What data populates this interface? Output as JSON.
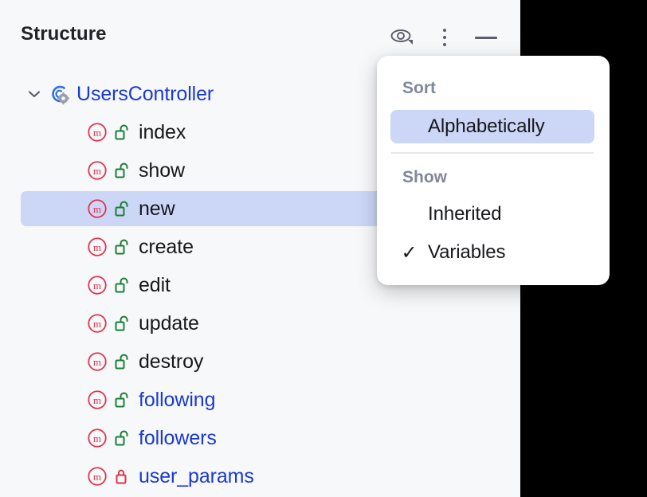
{
  "panel": {
    "title": "Structure",
    "header_actions": [
      {
        "name": "eye-icon",
        "label": "Show/Hide options"
      },
      {
        "name": "more-vertical-icon",
        "label": "Options"
      },
      {
        "name": "minimize-icon",
        "label": "Hide"
      }
    ]
  },
  "tree": {
    "root": {
      "label": "UsersController",
      "icon": "class-controller-icon",
      "expanded": true,
      "chevron": "chevron-down-icon"
    },
    "members": [
      {
        "label": "index",
        "icon": "method-icon",
        "visibility": "public",
        "lock_icon": "lock-open-icon",
        "selected": false,
        "link": false
      },
      {
        "label": "show",
        "icon": "method-icon",
        "visibility": "public",
        "lock_icon": "lock-open-icon",
        "selected": false,
        "link": false
      },
      {
        "label": "new",
        "icon": "method-icon",
        "visibility": "public",
        "lock_icon": "lock-open-icon",
        "selected": true,
        "link": false
      },
      {
        "label": "create",
        "icon": "method-icon",
        "visibility": "public",
        "lock_icon": "lock-open-icon",
        "selected": false,
        "link": false
      },
      {
        "label": "edit",
        "icon": "method-icon",
        "visibility": "public",
        "lock_icon": "lock-open-icon",
        "selected": false,
        "link": false
      },
      {
        "label": "update",
        "icon": "method-icon",
        "visibility": "public",
        "lock_icon": "lock-open-icon",
        "selected": false,
        "link": false
      },
      {
        "label": "destroy",
        "icon": "method-icon",
        "visibility": "public",
        "lock_icon": "lock-open-icon",
        "selected": false,
        "link": false
      },
      {
        "label": "following",
        "icon": "method-icon",
        "visibility": "public",
        "lock_icon": "lock-open-icon",
        "selected": false,
        "link": true
      },
      {
        "label": "followers",
        "icon": "method-icon",
        "visibility": "public",
        "lock_icon": "lock-open-icon",
        "selected": false,
        "link": true
      },
      {
        "label": "user_params",
        "icon": "method-icon",
        "visibility": "private",
        "lock_icon": "lock-closed-icon",
        "selected": false,
        "link": true
      }
    ]
  },
  "popup": {
    "sort_label": "Sort",
    "show_label": "Show",
    "sort_items": [
      {
        "label": "Alphabetically",
        "checked": false,
        "highlighted": true
      }
    ],
    "show_items": [
      {
        "label": "Inherited",
        "checked": false,
        "highlighted": false
      },
      {
        "label": "Variables",
        "checked": true,
        "highlighted": false
      }
    ],
    "check_glyph": "✓"
  },
  "colors": {
    "panel_background": "#f7f8fa",
    "selection": "#ccd6f6",
    "link_text": "#1a3ad1",
    "method_icon": "#e0334c",
    "lock_open": "#1a7f37",
    "lock_closed": "#e0334c",
    "group_label": "#82869a",
    "backdrop": "#000000"
  }
}
